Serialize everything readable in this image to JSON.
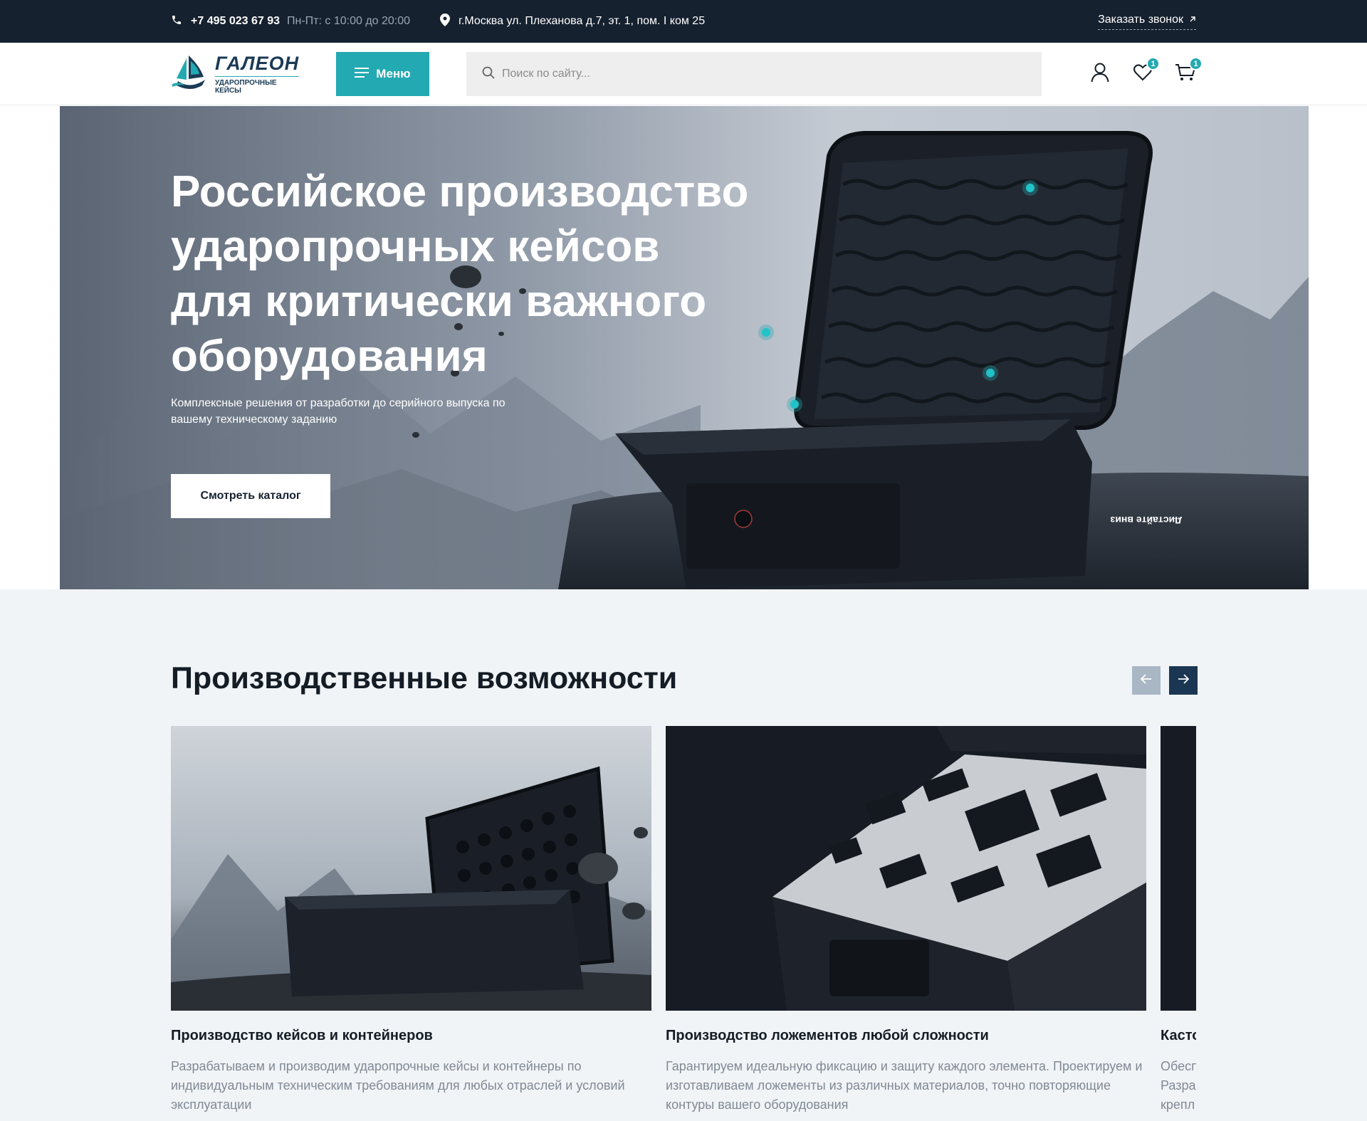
{
  "topbar": {
    "phone": "+7 495 023 67 93",
    "hours": "Пн-Пт: с 10:00 до 20:00",
    "address": "г.Москва ул. Плеханова д.7, эт. 1, пом. I ком 25",
    "callback_label": "Заказать звонок"
  },
  "header": {
    "logo_name": "ГАЛЕОН",
    "logo_sub": "УДАРОПРОЧНЫЕ КЕЙСЫ",
    "menu_label": "Меню",
    "search_placeholder": "Поиск по сайту...",
    "favorites_count": "1",
    "cart_count": "1"
  },
  "hero": {
    "title_lines": [
      "Российское производство",
      "ударопрочных кейсов",
      "для критически важного",
      "оборудования"
    ],
    "subtitle": "Комплексные решения от разработки до серийного выпуска по вашему техническому заданию",
    "cta_label": "Смотреть каталог",
    "scroll_label": "Листайте вниз"
  },
  "capabilities": {
    "title": "Производственные возможности",
    "cards": [
      {
        "title": "Производство кейсов и контейнеров",
        "text": "Разрабатываем и производим ударопрочные кейсы и контейнеры по индивидуальным техническим требованиям для любых отраслей и условий эксплуатации"
      },
      {
        "title": "Производство ложементов любой сложности",
        "text": "Гарантируем идеальную фиксацию и защиту каждого элемента. Проектируем и изготавливаем ложементы из различных материалов, точно повторяющие контуры вашего оборудования"
      },
      {
        "title": "Касто",
        "text": "Обесп Разра крепл"
      }
    ]
  },
  "colors": {
    "accent": "#23a9b1",
    "dark": "#16212f",
    "navy": "#1a3652"
  }
}
